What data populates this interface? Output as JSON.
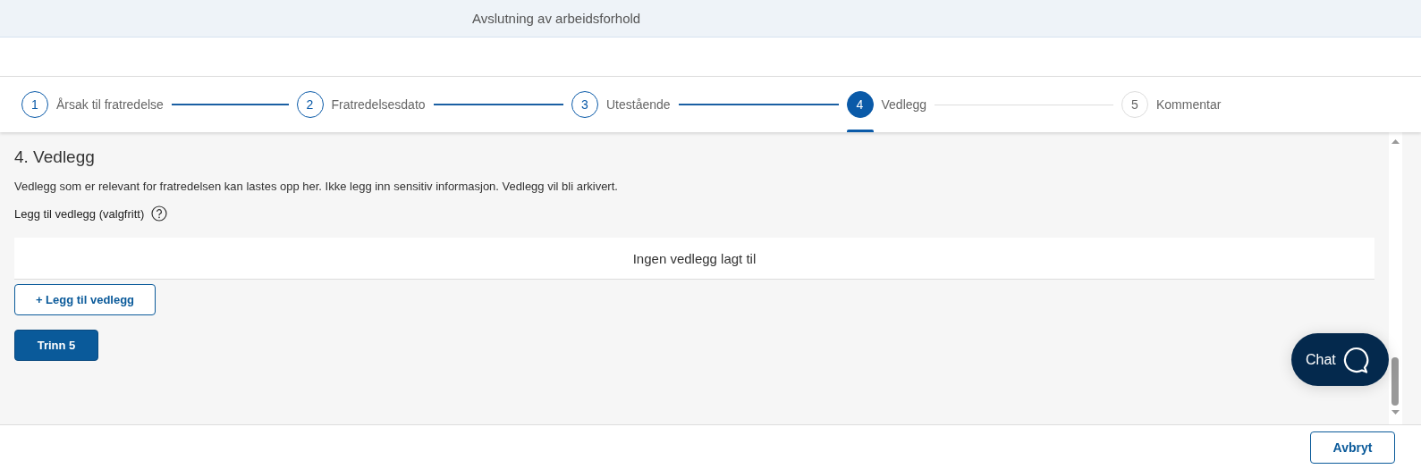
{
  "header": {
    "title": "Avslutning av arbeidsforhold"
  },
  "steps": [
    {
      "number": "1",
      "label": "Årsak til fratredelse",
      "done": true,
      "selected": false
    },
    {
      "number": "2",
      "label": "Fratredelsesdato",
      "done": true,
      "selected": false
    },
    {
      "number": "3",
      "label": "Utestående",
      "done": true,
      "selected": false
    },
    {
      "number": "4",
      "label": "Vedlegg",
      "done": false,
      "selected": true
    },
    {
      "number": "5",
      "label": "Kommentar",
      "done": false,
      "selected": false
    }
  ],
  "section": {
    "heading": "4. Vedlegg",
    "description": "Vedlegg som er relevant for fratredelsen kan lastes opp her. Ikke legg inn sensitiv informasjon. Vedlegg vil bli arkivert.",
    "field_label": "Legg til vedlegg (valgfritt)",
    "empty_message": "Ingen vedlegg lagt til",
    "add_button": "+ Legg til vedlegg",
    "next_button": "Trinn 5"
  },
  "chat": {
    "label": "Chat"
  },
  "footer": {
    "cancel_button": "Avbryt"
  }
}
